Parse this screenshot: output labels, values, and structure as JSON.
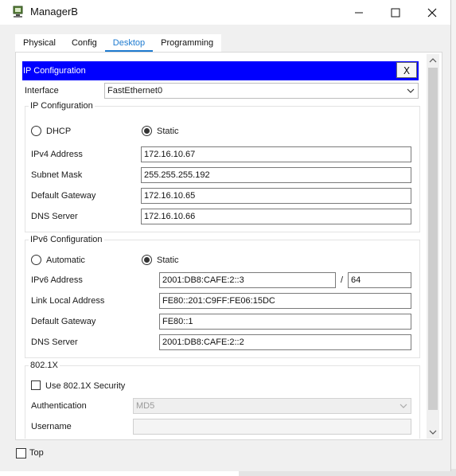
{
  "window": {
    "title": "ManagerB",
    "minimize_icon": "minimize-icon",
    "maximize_icon": "maximize-icon",
    "close_icon": "close-icon"
  },
  "tabs": [
    {
      "label": "Physical",
      "active": false
    },
    {
      "label": "Config",
      "active": false
    },
    {
      "label": "Desktop",
      "active": true
    },
    {
      "label": "Programming",
      "active": false
    }
  ],
  "ip_config": {
    "title": "IP Configuration",
    "close_label": "X",
    "interface_label": "Interface",
    "interface_value": "FastEthernet0",
    "ipv4": {
      "group_title": "IP Configuration",
      "dhcp_label": "DHCP",
      "static_label": "Static",
      "mode": "Static",
      "address_label": "IPv4 Address",
      "address": "172.16.10.67",
      "mask_label": "Subnet Mask",
      "mask": "255.255.255.192",
      "gateway_label": "Default Gateway",
      "gateway": "172.16.10.65",
      "dns_label": "DNS Server",
      "dns": "172.16.10.66"
    },
    "ipv6": {
      "group_title": "IPv6 Configuration",
      "automatic_label": "Automatic",
      "static_label": "Static",
      "mode": "Static",
      "address_label": "IPv6 Address",
      "address": "2001:DB8:CAFE:2::3",
      "prefix_sep": "/",
      "prefix": "64",
      "link_local_label": "Link Local Address",
      "link_local": "FE80::201:C9FF:FE06:15DC",
      "gateway_label": "Default Gateway",
      "gateway": "FE80::1",
      "dns_label": "DNS Server",
      "dns": "2001:DB8:CAFE:2::2"
    },
    "dot1x": {
      "group_title": "802.1X",
      "use_label": "Use 802.1X Security",
      "use_checked": false,
      "auth_label": "Authentication",
      "auth_value": "MD5",
      "username_label": "Username",
      "username_value": ""
    }
  },
  "footer": {
    "top_label": "Top",
    "top_checked": false
  },
  "colors": {
    "title_bar": "#0000ff",
    "active_tab": "#1e7bd0"
  }
}
